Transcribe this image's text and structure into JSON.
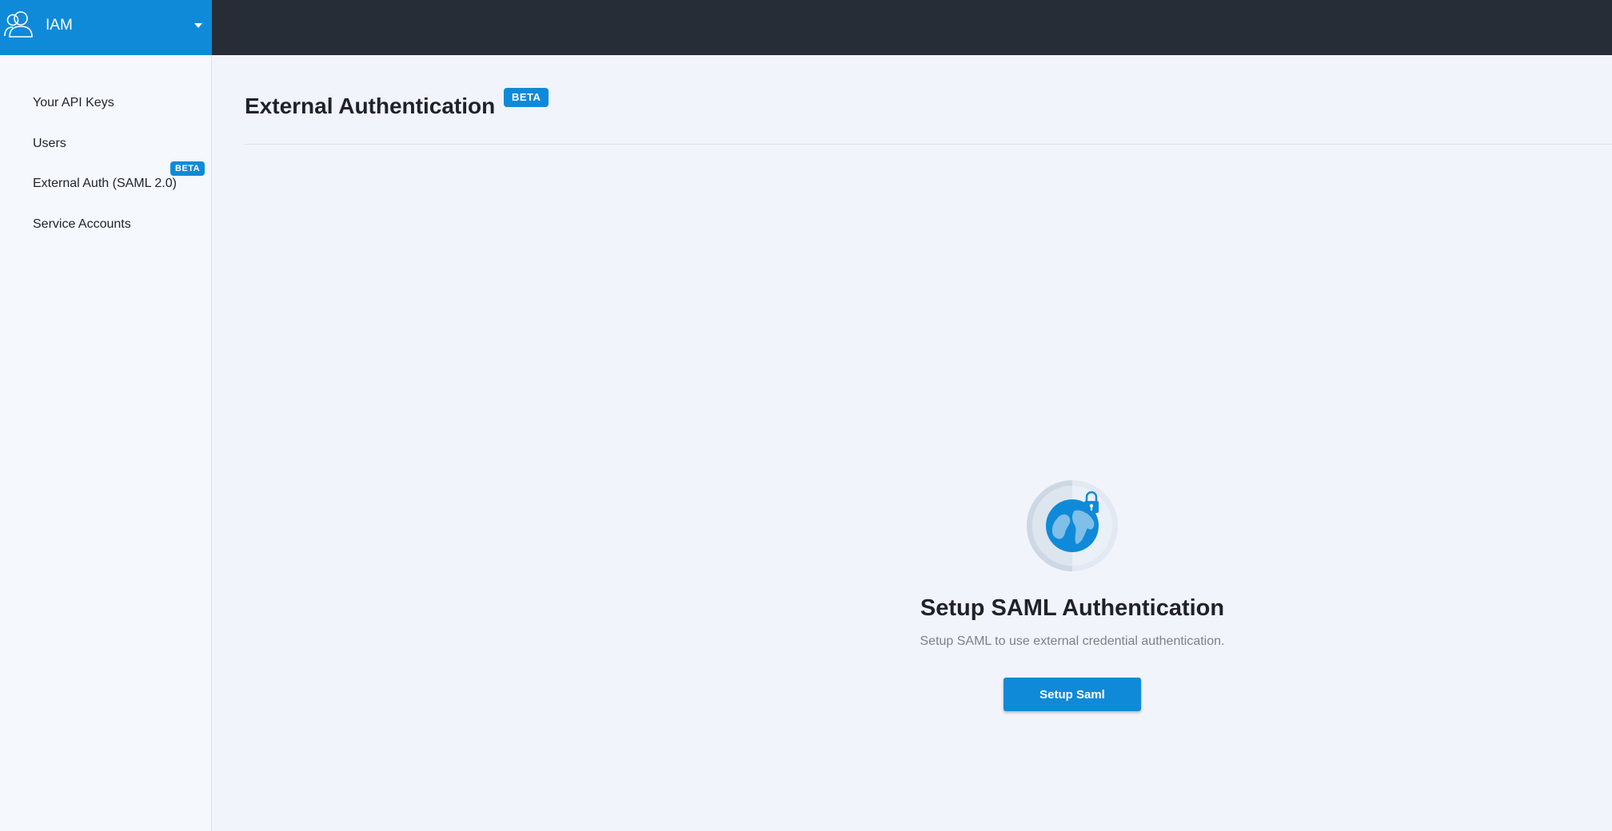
{
  "topbar": {
    "app_name": "IAM",
    "app_icon": "users-icon",
    "dropdown_icon": "caret-down-icon"
  },
  "sidebar": {
    "items": [
      {
        "label": "Your API Keys"
      },
      {
        "label": "Users"
      },
      {
        "label": "External Auth (SAML 2.0)",
        "badge": "BETA"
      },
      {
        "label": "Service Accounts"
      }
    ]
  },
  "main": {
    "title": "External Authentication",
    "title_badge": "BETA",
    "empty_state": {
      "icon": "globe-lock-icon",
      "heading": "Setup SAML Authentication",
      "description": "Setup SAML to use external credential authentication.",
      "button_label": "Setup Saml"
    }
  },
  "colors": {
    "accent": "#0f8ad8",
    "topbar": "#262d37",
    "background": "#f1f4fa",
    "sidebar": "#f5f8fd"
  }
}
